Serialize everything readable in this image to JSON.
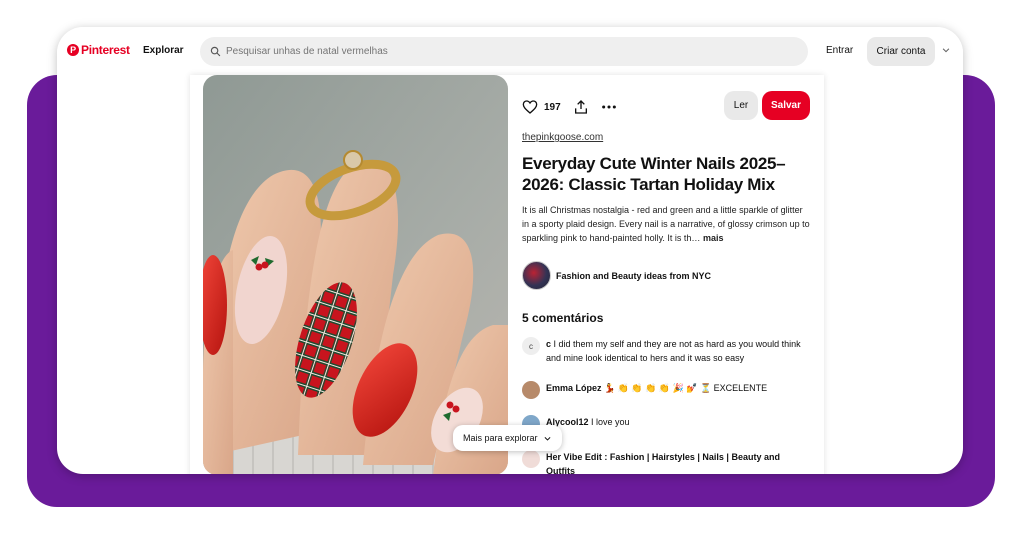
{
  "header": {
    "logo_text": "Pinterest",
    "explore_label": "Explorar",
    "search_placeholder": "Pesquisar unhas de natal vermelhas",
    "login_label": "Entrar",
    "signup_label": "Criar conta"
  },
  "pin": {
    "likes": "197",
    "read_label": "Ler",
    "save_label": "Salvar",
    "source": "thepinkgoose.com",
    "title": "Everyday Cute Winter Nails 2025–2026: Classic Tartan Holiday Mix",
    "description": "It is all Christmas nostalgia - red and green and a little sparkle of glitter in a sporty plaid design. Every nail is a narrative, of glossy crimson up to sparkling pink to hand-painted holly. It is th…",
    "more_label": " mais",
    "board_name": "Fashion and Beauty ideas from NYC"
  },
  "comments": {
    "count_label": "5 comentários",
    "items": [
      {
        "avatar": "c",
        "user": "c",
        "text": " I did them my self and they are not as hard as you would think and mine look identical to hers and it was so easy"
      },
      {
        "avatar": "",
        "user": "Emma López",
        "text": " 💃 👏 👏 👏 👏 🎉 💅 ⏳ EXCELENTE"
      },
      {
        "avatar": "",
        "user": "Alycool12",
        "text": " I love you"
      },
      {
        "avatar": "",
        "user": "Her Vibe Edit : Fashion | Hairstyles | Nails | Beauty and Outfits",
        "text": ""
      }
    ]
  },
  "explore_more_label": "Mais para explorar",
  "colors": {
    "brand": "#e60023",
    "frame_bg": "#6a1b9a"
  }
}
